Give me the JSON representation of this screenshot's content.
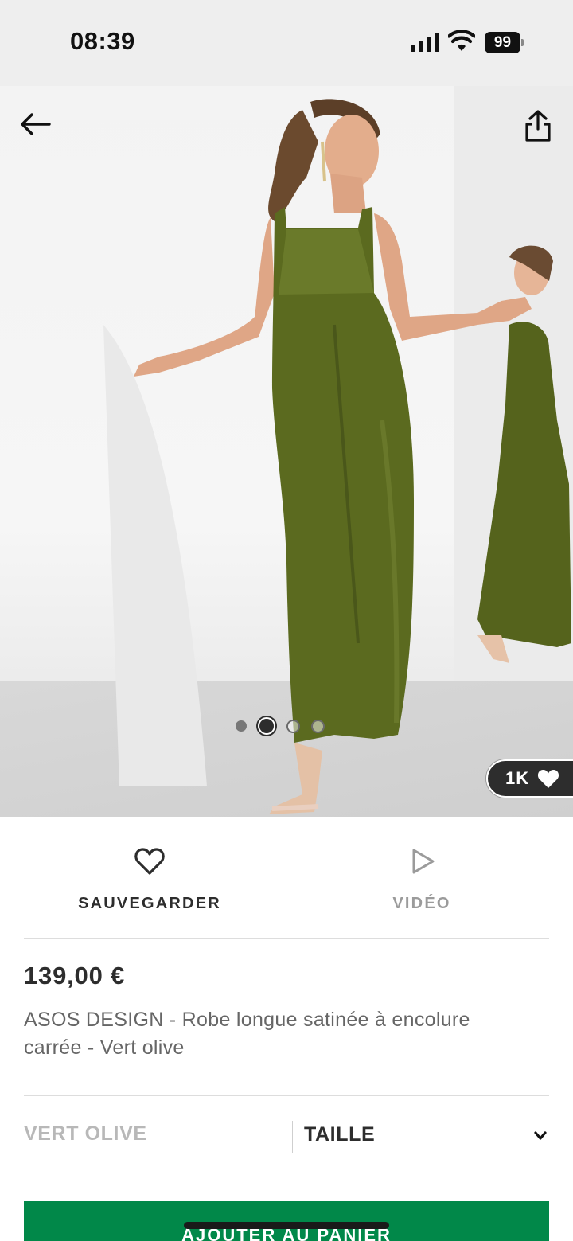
{
  "status_bar": {
    "time": "08:39",
    "battery": "99",
    "icons": [
      "signal-icon",
      "wifi-icon",
      "battery-icon"
    ]
  },
  "hero": {
    "icons": [
      "back-arrow-icon",
      "share-icon",
      "heart-icon"
    ],
    "carousel": {
      "total": 4,
      "active_index": 1
    },
    "likes": "1K"
  },
  "actions": {
    "save_label": "SAUVEGARDER",
    "video_label": "VIDÉO"
  },
  "product": {
    "price": "139,00 €",
    "name": "ASOS DESIGN - Robe longue satinée à encolure carrée - Vert olive",
    "colour": "VERT OLIVE",
    "size_label": "TAILLE"
  },
  "cta": {
    "add_to_bag": "AJOUTER AU PANIER",
    "color": "#018849"
  },
  "colors": {
    "dress": "#5b6a1f",
    "text_primary": "#2d2d2d",
    "text_muted": "#9b9b9b"
  }
}
